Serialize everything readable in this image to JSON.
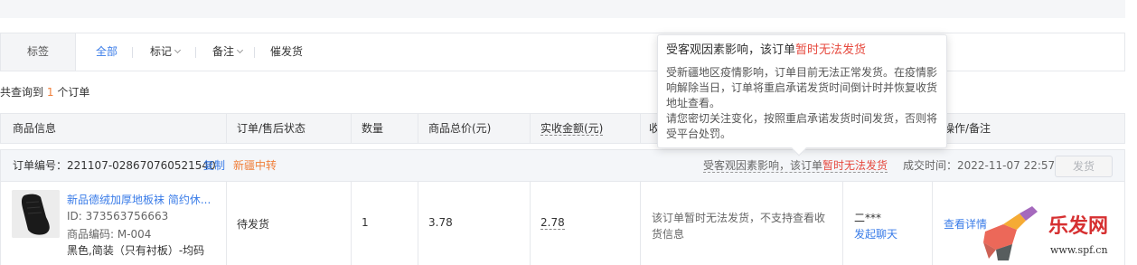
{
  "filter": {
    "label": "标签",
    "items": [
      "全部",
      "标记",
      "备注",
      "催发货"
    ]
  },
  "summary": {
    "prefix": "共查询到",
    "count": "1",
    "suffix": "个订单"
  },
  "table": {
    "headers": [
      "商品信息",
      "订单/售后状态",
      "数量",
      "商品总价(元)",
      "实收金额(元)",
      "收",
      "操作/备注"
    ]
  },
  "order": {
    "id_label": "订单编号：",
    "id": "221107-028670760521540",
    "copy": "复制",
    "region_tag": "新疆中转",
    "notice_prefix": "受客观因素影响，该订单",
    "notice_red": "暂时无法发货",
    "deal_time_label": "成交时间：",
    "deal_time": "2022-11-07 22:57",
    "ship_button": "发货",
    "product": {
      "title": "新品德绒加厚地板袜 简约休...",
      "id_line": "ID: 373563756663",
      "code_line": "商品编码: M-004",
      "spec_line": "黑色,简装（只有衬板）-均码"
    },
    "status": "待发货",
    "quantity": "1",
    "total_price": "3.78",
    "received": "2.78",
    "address_note_line1": "该订单暂时无法发货，不支持查看收",
    "address_note_line2": "货信息",
    "buyer": "二***",
    "chat_link": "发起聊天",
    "detail_link": "查看详情"
  },
  "tooltip": {
    "title_prefix": "受客观因素影响，该订单",
    "title_red": "暂时无法发货",
    "body_line1": "受新疆地区疫情影响，订单目前无法正常发货。在疫情影",
    "body_line2": "响解除当日，订单将重启承诺发货时间倒计时并恢复收货",
    "body_line3": "地址查看。",
    "body_line4": "请您密切关注变化，按照重启承诺发货时间发货，否则将",
    "body_line5": "受平台处罚。"
  },
  "watermark": {
    "brand": "乐发网",
    "url": "www.spf.cn"
  },
  "colors": {
    "link": "#3a7ce8",
    "orange": "#f07f3a",
    "red": "#e6483d"
  }
}
